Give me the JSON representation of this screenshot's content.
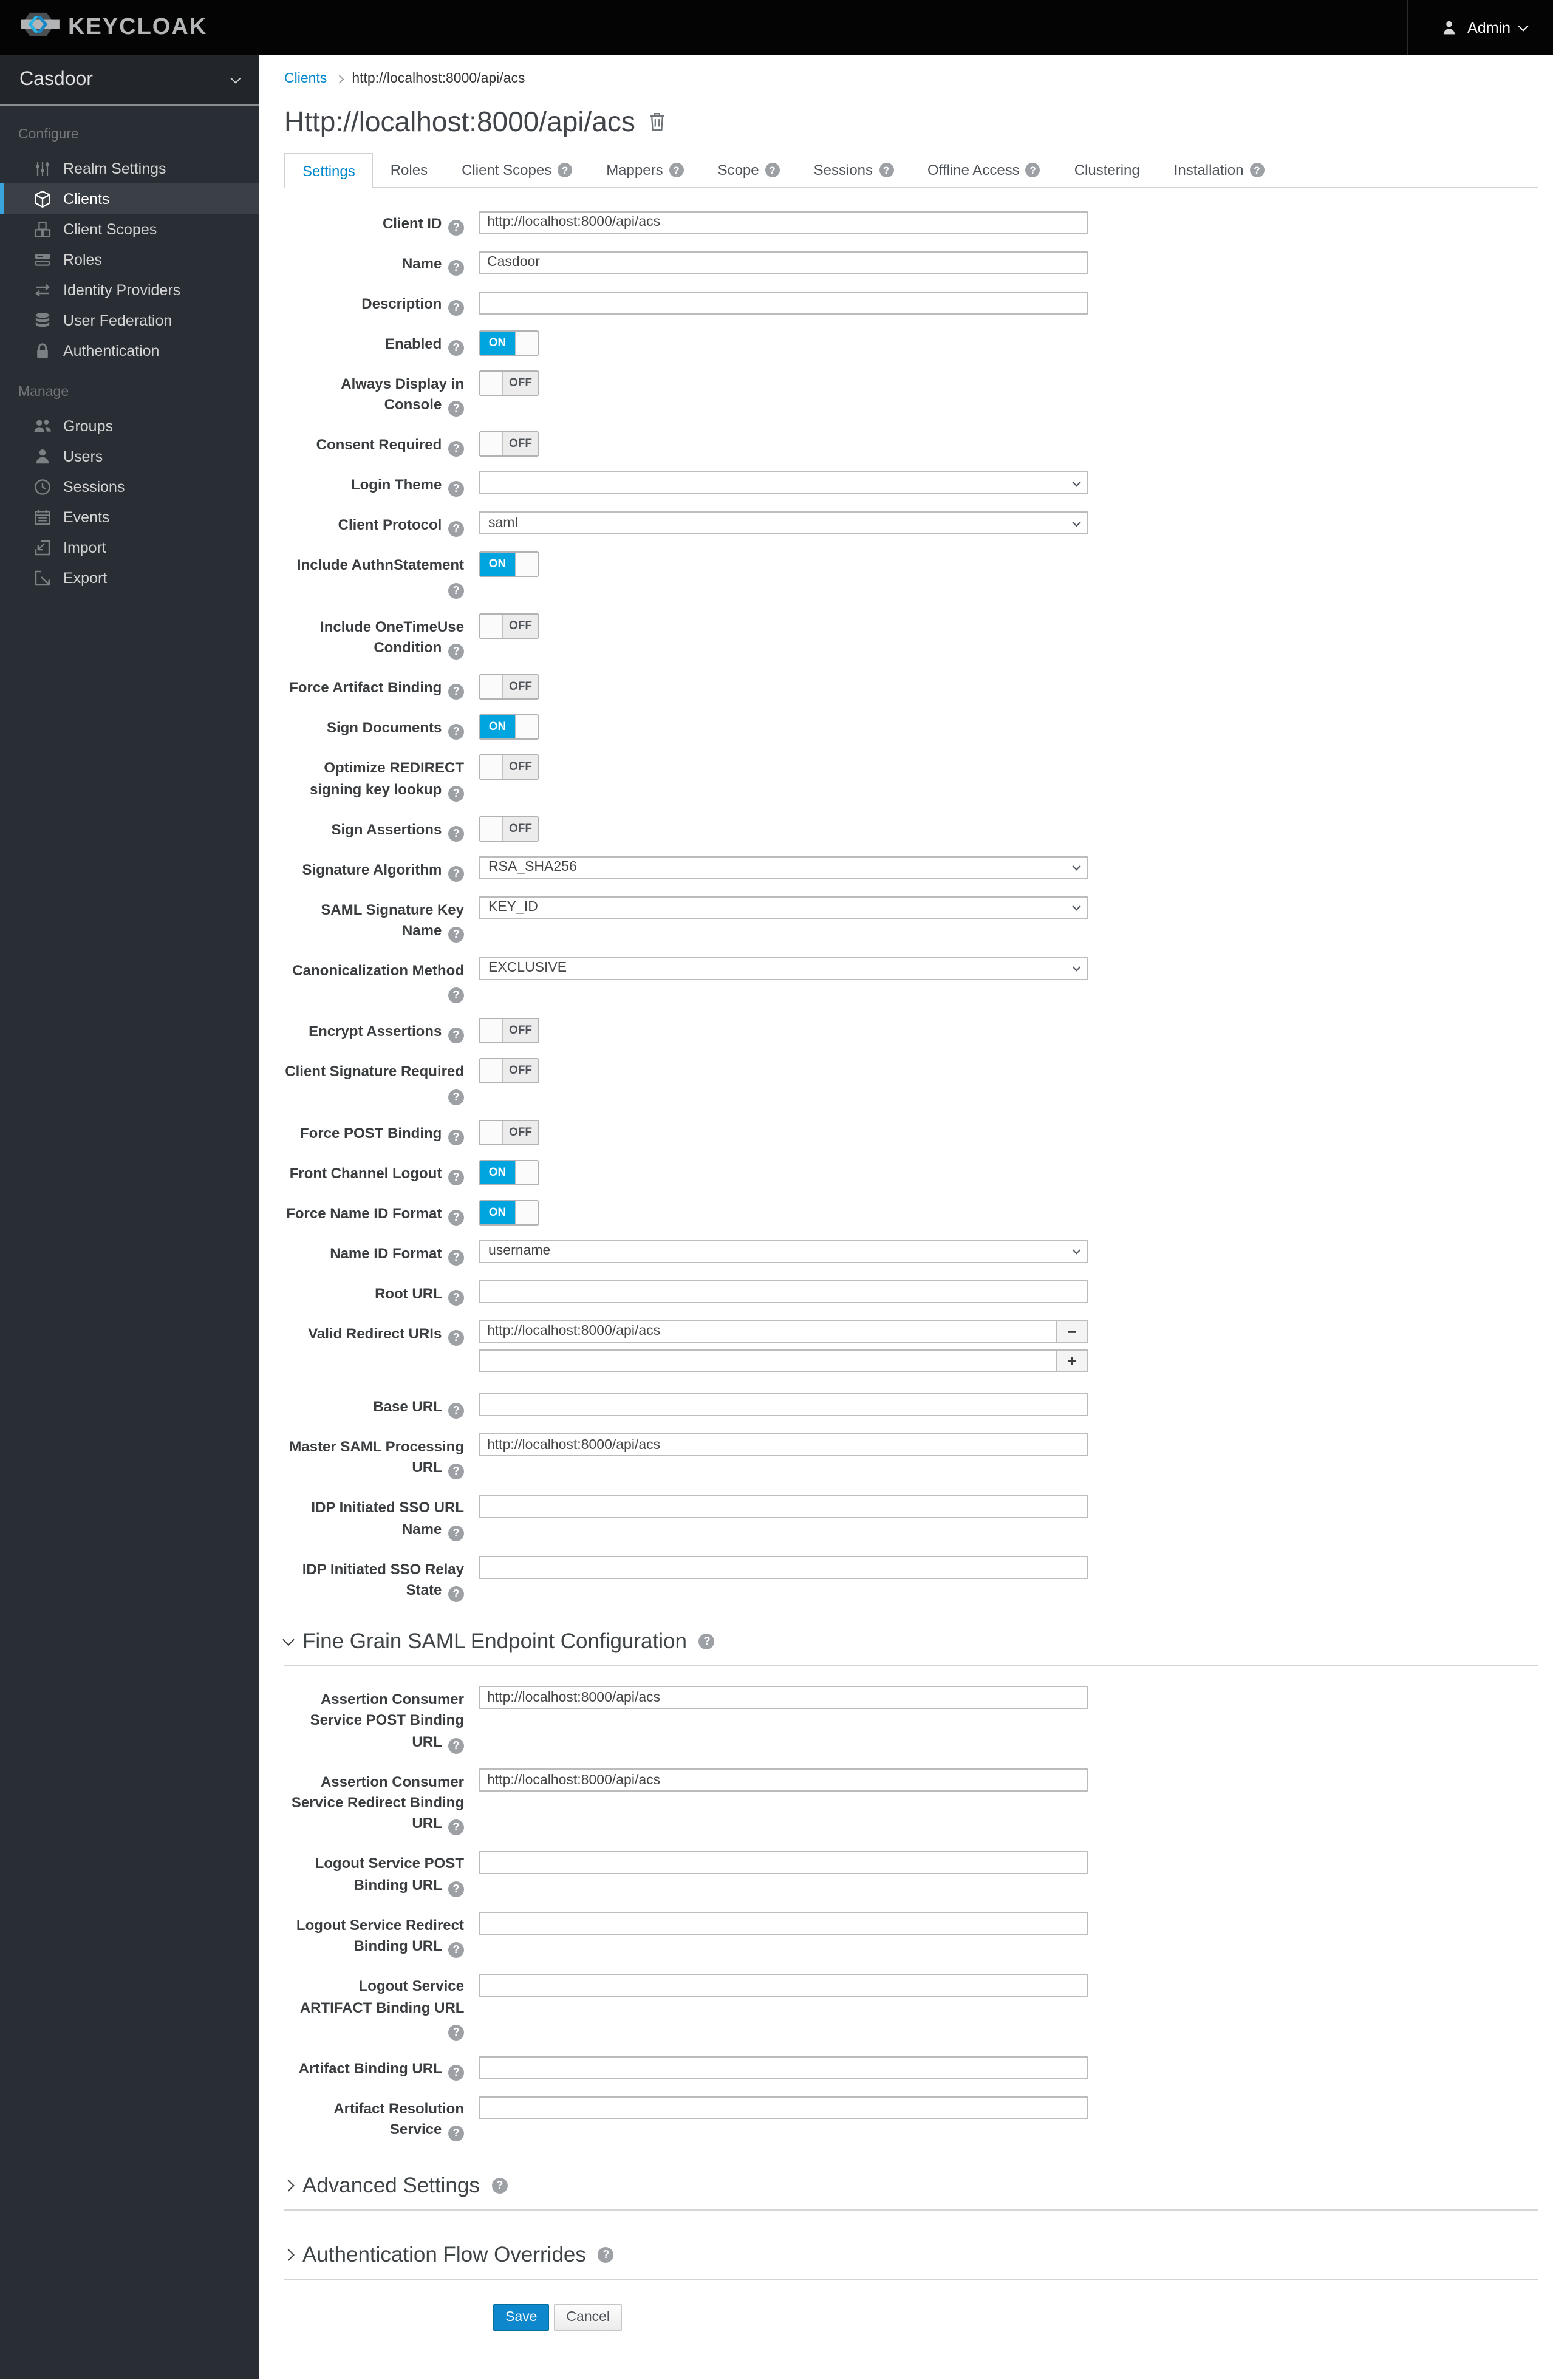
{
  "colors": {
    "accent_blue": "#0088ce",
    "toggle_on_blue": "#00a4de",
    "sidebar_active_bar": "#39a5dc",
    "header_bg": "#040404",
    "sidebar_bg": "#292e34"
  },
  "header": {
    "brand": "KEYCLOAK",
    "brand_icon": "keycloak-logo-icon",
    "user": {
      "label": "Admin",
      "icon": "user-icon",
      "chevron": "chevron-down-icon"
    }
  },
  "sidebar": {
    "realm": "Casdoor",
    "realm_chevron": "chevron-down-icon",
    "sections": [
      {
        "label": "Configure",
        "items": [
          {
            "label": "Realm Settings",
            "icon": "sliders-icon",
            "active": false
          },
          {
            "label": "Clients",
            "icon": "cube-icon",
            "active": true
          },
          {
            "label": "Client Scopes",
            "icon": "cubes-icon",
            "active": false
          },
          {
            "label": "Roles",
            "icon": "roles-icon",
            "active": false
          },
          {
            "label": "Identity Providers",
            "icon": "swap-arrows-icon",
            "active": false
          },
          {
            "label": "User Federation",
            "icon": "database-icon",
            "active": false
          },
          {
            "label": "Authentication",
            "icon": "lock-icon",
            "active": false
          }
        ]
      },
      {
        "label": "Manage",
        "items": [
          {
            "label": "Groups",
            "icon": "groups-icon",
            "active": false
          },
          {
            "label": "Users",
            "icon": "user-icon",
            "active": false
          },
          {
            "label": "Sessions",
            "icon": "clock-icon",
            "active": false
          },
          {
            "label": "Events",
            "icon": "calendar-icon",
            "active": false
          },
          {
            "label": "Import",
            "icon": "import-icon",
            "active": false
          },
          {
            "label": "Export",
            "icon": "export-icon",
            "active": false
          }
        ]
      }
    ]
  },
  "breadcrumb": {
    "items": [
      {
        "label": "Clients",
        "link": true
      },
      {
        "label": "http://localhost:8000/api/acs",
        "link": false
      }
    ]
  },
  "page": {
    "title": "Http://localhost:8000/api/acs",
    "delete_icon": "trash-icon"
  },
  "tabs": [
    {
      "label": "Settings",
      "active": true,
      "help": false
    },
    {
      "label": "Roles",
      "active": false,
      "help": false
    },
    {
      "label": "Client Scopes",
      "active": false,
      "help": true
    },
    {
      "label": "Mappers",
      "active": false,
      "help": true
    },
    {
      "label": "Scope",
      "active": false,
      "help": true
    },
    {
      "label": "Sessions",
      "active": false,
      "help": true
    },
    {
      "label": "Offline Access",
      "active": false,
      "help": true
    },
    {
      "label": "Clustering",
      "active": false,
      "help": false
    },
    {
      "label": "Installation",
      "active": false,
      "help": true
    }
  ],
  "toggle_labels": {
    "on": "ON",
    "off": "OFF"
  },
  "form": {
    "rows": [
      {
        "type": "text",
        "label": "Client ID",
        "help": true,
        "value": "http://localhost:8000/api/acs"
      },
      {
        "type": "text",
        "label": "Name",
        "help": true,
        "value": "Casdoor"
      },
      {
        "type": "text",
        "label": "Description",
        "help": true,
        "value": ""
      },
      {
        "type": "toggle",
        "label": "Enabled",
        "help": true,
        "value": "ON"
      },
      {
        "type": "toggle",
        "label": "Always Display in Console",
        "help": true,
        "value": "OFF"
      },
      {
        "type": "toggle",
        "label": "Consent Required",
        "help": true,
        "value": "OFF"
      },
      {
        "type": "select",
        "label": "Login Theme",
        "help": true,
        "value": ""
      },
      {
        "type": "select",
        "label": "Client Protocol",
        "help": true,
        "value": "saml"
      },
      {
        "type": "toggle",
        "label": "Include AuthnStatement",
        "help": true,
        "value": "ON"
      },
      {
        "type": "toggle",
        "label": "Include OneTimeUse Condition",
        "help": true,
        "value": "OFF"
      },
      {
        "type": "toggle",
        "label": "Force Artifact Binding",
        "help": true,
        "value": "OFF"
      },
      {
        "type": "toggle",
        "label": "Sign Documents",
        "help": true,
        "value": "ON"
      },
      {
        "type": "toggle",
        "label": "Optimize REDIRECT signing key lookup",
        "help": true,
        "value": "OFF"
      },
      {
        "type": "toggle",
        "label": "Sign Assertions",
        "help": true,
        "value": "OFF"
      },
      {
        "type": "select",
        "label": "Signature Algorithm",
        "help": true,
        "value": "RSA_SHA256"
      },
      {
        "type": "select",
        "label": "SAML Signature Key Name",
        "help": true,
        "value": "KEY_ID"
      },
      {
        "type": "select",
        "label": "Canonicalization Method",
        "help": true,
        "value": "EXCLUSIVE"
      },
      {
        "type": "toggle",
        "label": "Encrypt Assertions",
        "help": true,
        "value": "OFF"
      },
      {
        "type": "toggle",
        "label": "Client Signature Required",
        "help": true,
        "value": "OFF"
      },
      {
        "type": "toggle",
        "label": "Force POST Binding",
        "help": true,
        "value": "OFF"
      },
      {
        "type": "toggle",
        "label": "Front Channel Logout",
        "help": true,
        "value": "ON"
      },
      {
        "type": "toggle",
        "label": "Force Name ID Format",
        "help": true,
        "value": "ON"
      },
      {
        "type": "select",
        "label": "Name ID Format",
        "help": true,
        "value": "username"
      },
      {
        "type": "text",
        "label": "Root URL",
        "help": true,
        "value": ""
      },
      {
        "type": "multivalue",
        "label": "Valid Redirect URIs",
        "help": true,
        "values": [
          "http://localhost:8000/api/acs",
          ""
        ],
        "remove_icon": "minus-icon",
        "add_icon": "plus-icon",
        "remove_glyph": "−",
        "add_glyph": "+"
      },
      {
        "type": "text",
        "label": "Base URL",
        "help": true,
        "value": ""
      },
      {
        "type": "text",
        "label": "Master SAML Processing URL",
        "help": true,
        "value": "http://localhost:8000/api/acs"
      },
      {
        "type": "text",
        "label": "IDP Initiated SSO URL Name",
        "help": true,
        "value": ""
      },
      {
        "type": "text",
        "label": "IDP Initiated SSO Relay State",
        "help": true,
        "value": ""
      },
      {
        "type": "section",
        "label": "Fine Grain SAML Endpoint Configuration",
        "help": true,
        "expanded": true
      },
      {
        "type": "text",
        "label": "Assertion Consumer Service POST Binding URL",
        "help": true,
        "value": "http://localhost:8000/api/acs"
      },
      {
        "type": "text",
        "label": "Assertion Consumer Service Redirect Binding URL",
        "help": true,
        "value": "http://localhost:8000/api/acs"
      },
      {
        "type": "text",
        "label": "Logout Service POST Binding URL",
        "help": true,
        "value": ""
      },
      {
        "type": "text",
        "label": "Logout Service Redirect Binding URL",
        "help": true,
        "value": ""
      },
      {
        "type": "text",
        "label": "Logout Service ARTIFACT Binding URL",
        "help": true,
        "value": ""
      },
      {
        "type": "text",
        "label": "Artifact Binding URL",
        "help": true,
        "value": ""
      },
      {
        "type": "text",
        "label": "Artifact Resolution Service",
        "help": true,
        "value": ""
      },
      {
        "type": "section",
        "label": "Advanced Settings",
        "help": true,
        "expanded": false
      },
      {
        "type": "section",
        "label": "Authentication Flow Overrides",
        "help": true,
        "expanded": false
      }
    ]
  },
  "actions": {
    "save": "Save",
    "cancel": "Cancel"
  },
  "help_glyph": "?"
}
